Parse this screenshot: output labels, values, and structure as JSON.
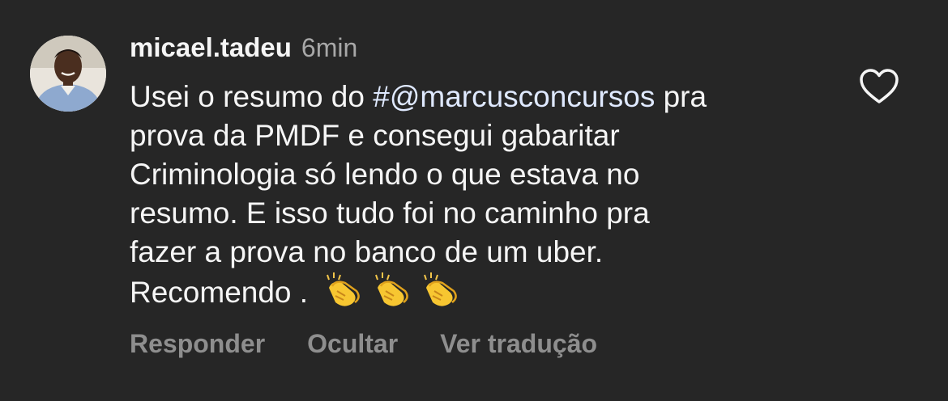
{
  "comment": {
    "username": "micael.tadeu",
    "time": "6min",
    "lines": [
      {
        "before": "Usei o resumo do ",
        "mention": "#@marcusconcursos",
        "after": " pra"
      },
      {
        "text": "prova da PMDF e consegui gabaritar"
      },
      {
        "text": "Criminologia só lendo o que estava no"
      },
      {
        "text": "resumo.  E isso tudo foi no caminho pra"
      },
      {
        "text": "fazer a prova no banco de um uber."
      },
      {
        "text": "Recomendo . ",
        "emoji": "👏👏👏"
      }
    ]
  },
  "actions": {
    "reply": "Responder",
    "hide": "Ocultar",
    "translate": "Ver tradução"
  },
  "icons": {
    "like": "heart-outline-icon",
    "reaction": "clapping-hands-icon"
  },
  "colors": {
    "background": "#262626",
    "text": "#f5f5f5",
    "muted": "#8e8e8e",
    "mention": "#dfe9ff"
  }
}
